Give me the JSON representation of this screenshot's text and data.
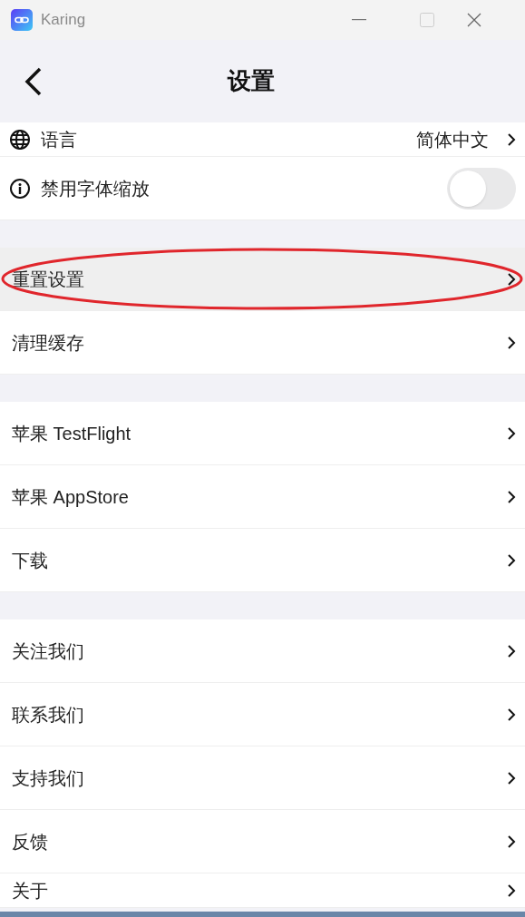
{
  "window": {
    "title": "Karing"
  },
  "header": {
    "title": "设置"
  },
  "sections": [
    {
      "rows": [
        {
          "kind": "select",
          "label": "语言",
          "value": "简体中文",
          "highlighted": false
        },
        {
          "kind": "toggle",
          "label": "禁用字体缩放",
          "on": false,
          "highlighted": false
        }
      ]
    },
    {
      "rows": [
        {
          "kind": "link",
          "label": "重置设置",
          "highlighted": true,
          "circled": true
        },
        {
          "kind": "link",
          "label": "清理缓存",
          "highlighted": false
        }
      ]
    },
    {
      "rows": [
        {
          "kind": "link",
          "label": "苹果 TestFlight",
          "highlighted": false
        },
        {
          "kind": "link",
          "label": "苹果 AppStore",
          "highlighted": false
        },
        {
          "kind": "link",
          "label": "下载",
          "highlighted": false
        }
      ]
    },
    {
      "rows": [
        {
          "kind": "link",
          "label": "关注我们",
          "highlighted": false
        },
        {
          "kind": "link",
          "label": "联系我们",
          "highlighted": false
        },
        {
          "kind": "link",
          "label": "支持我们",
          "highlighted": false
        },
        {
          "kind": "link",
          "label": "反馈",
          "highlighted": false
        },
        {
          "kind": "link",
          "label": "关于",
          "highlighted": false
        }
      ]
    }
  ]
}
